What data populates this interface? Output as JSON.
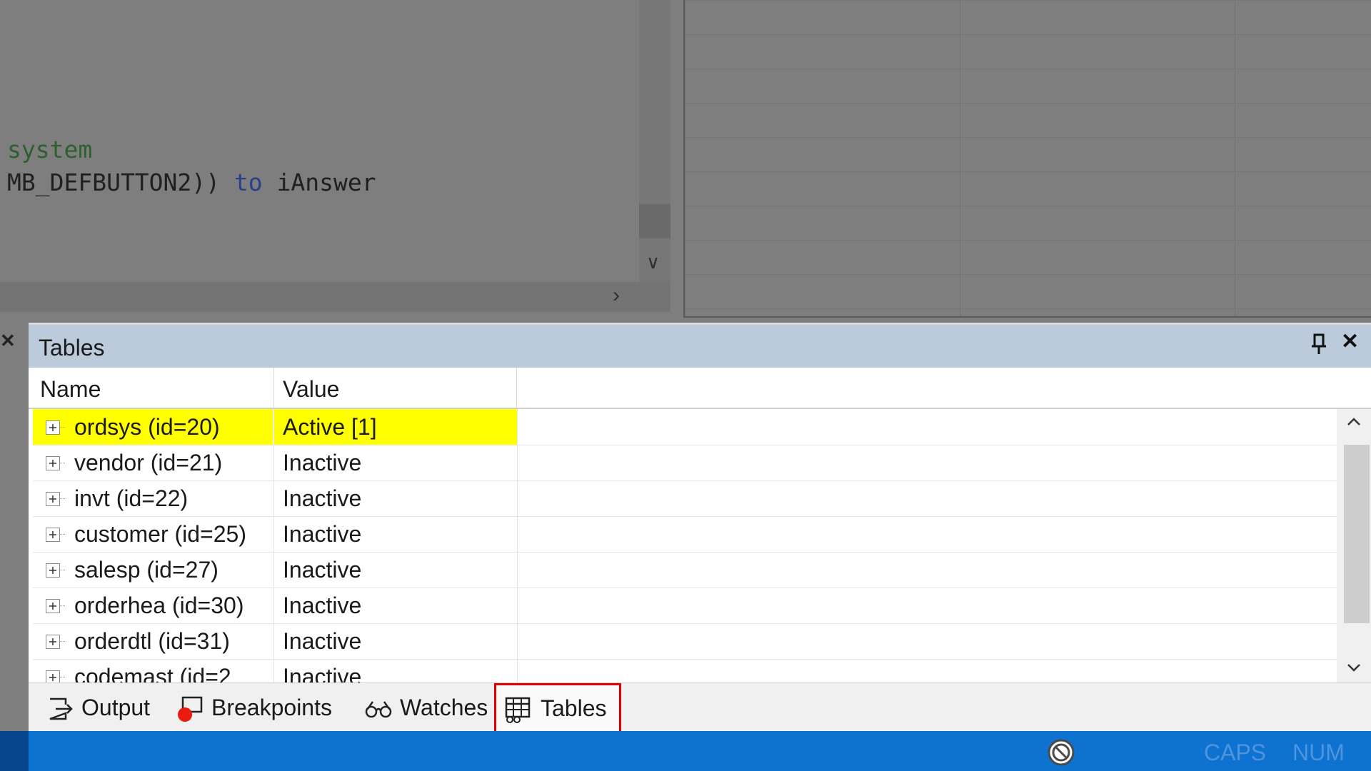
{
  "editor": {
    "line1": "system",
    "line2_part1": "MB_DEFBUTTON2)) ",
    "line2_keyword": "to",
    "line2_part2": " iAnswer"
  },
  "tables_panel": {
    "title": "Tables",
    "columns": {
      "name": "Name",
      "value": "Value"
    },
    "rows": [
      {
        "name": "ordsys (id=20)",
        "value": "Active [1]",
        "selected": true
      },
      {
        "name": "vendor (id=21)",
        "value": "Inactive"
      },
      {
        "name": "invt (id=22)",
        "value": "Inactive"
      },
      {
        "name": "customer (id=25)",
        "value": "Inactive"
      },
      {
        "name": "salesp (id=27)",
        "value": "Inactive"
      },
      {
        "name": "orderhea (id=30)",
        "value": "Inactive"
      },
      {
        "name": "orderdtl (id=31)",
        "value": "Inactive"
      },
      {
        "name": "codemast (id=2",
        "value": "Inactive"
      }
    ],
    "highlight_color": "#ffff00"
  },
  "tabs": [
    {
      "label": "Output",
      "icon": "output-icon"
    },
    {
      "label": "Breakpoints",
      "icon": "breakpoint-icon"
    },
    {
      "label": "Watches",
      "icon": "glasses-icon"
    },
    {
      "label": "Tables",
      "icon": "table-icon",
      "active": true
    }
  ],
  "statusbar": {
    "caps": "CAPS",
    "num": "NUM",
    "color": "#0d72d0"
  }
}
